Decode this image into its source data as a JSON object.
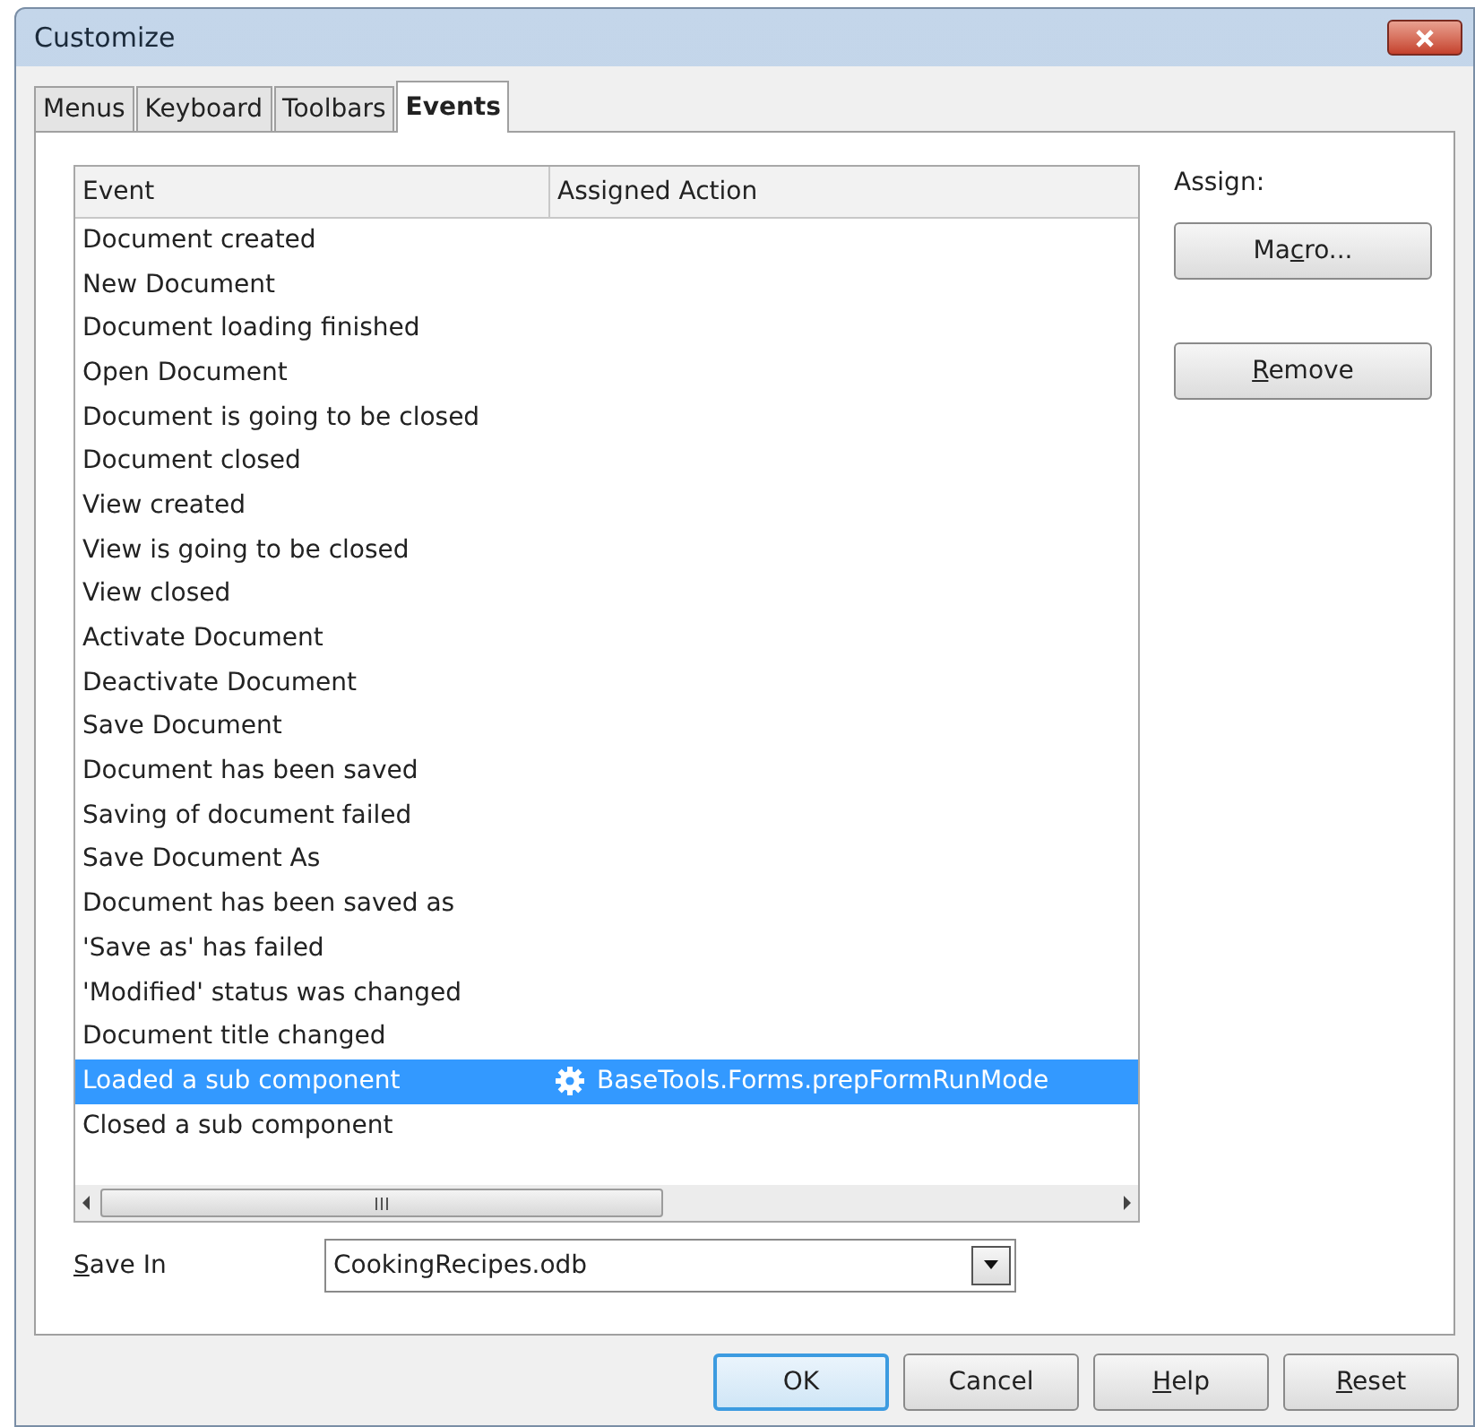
{
  "window": {
    "title": "Customize"
  },
  "tabs": [
    {
      "label": "Menus",
      "selected": false
    },
    {
      "label": "Keyboard",
      "selected": false
    },
    {
      "label": "Toolbars",
      "selected": false
    },
    {
      "label": "Events",
      "selected": true
    }
  ],
  "table": {
    "columns": [
      "Event",
      "Assigned Action"
    ],
    "rows": [
      {
        "event": "Document created",
        "selected": false
      },
      {
        "event": "New Document",
        "selected": false
      },
      {
        "event": "Document loading finished",
        "selected": false
      },
      {
        "event": "Open Document",
        "selected": false
      },
      {
        "event": "Document is going to be closed",
        "selected": false
      },
      {
        "event": "Document closed",
        "selected": false
      },
      {
        "event": "View created",
        "selected": false
      },
      {
        "event": "View is going to be closed",
        "selected": false
      },
      {
        "event": "View closed",
        "selected": false
      },
      {
        "event": "Activate Document",
        "selected": false
      },
      {
        "event": "Deactivate Document",
        "selected": false
      },
      {
        "event": "Save Document",
        "selected": false
      },
      {
        "event": "Document has been saved",
        "selected": false
      },
      {
        "event": "Saving of document failed",
        "selected": false
      },
      {
        "event": "Save Document As",
        "selected": false
      },
      {
        "event": "Document has been saved as",
        "selected": false
      },
      {
        "event": "'Save as' has failed",
        "selected": false
      },
      {
        "event": "'Modified' status was changed",
        "selected": false
      },
      {
        "event": "Document title changed",
        "selected": false
      },
      {
        "event": "Loaded a sub component",
        "selected": true,
        "action": "BaseTools.Forms.prepFormRunMode"
      },
      {
        "event": "Closed a sub component",
        "selected": false
      }
    ]
  },
  "assign": {
    "label": "Assign:",
    "buttons": [
      {
        "before": "Ma",
        "mnemonic": "c",
        "after": "ro..."
      },
      {
        "mnemonic": "R",
        "after": "emove"
      }
    ]
  },
  "save_in": {
    "mnemonic": "S",
    "after": "ave In",
    "value": "CookingRecipes.odb"
  },
  "buttons": [
    {
      "after": "OK",
      "default": true
    },
    {
      "after": "Cancel",
      "default": false
    },
    {
      "mnemonic": "H",
      "after": "elp",
      "default": false
    },
    {
      "mnemonic": "R",
      "after": "eset",
      "default": false
    }
  ]
}
